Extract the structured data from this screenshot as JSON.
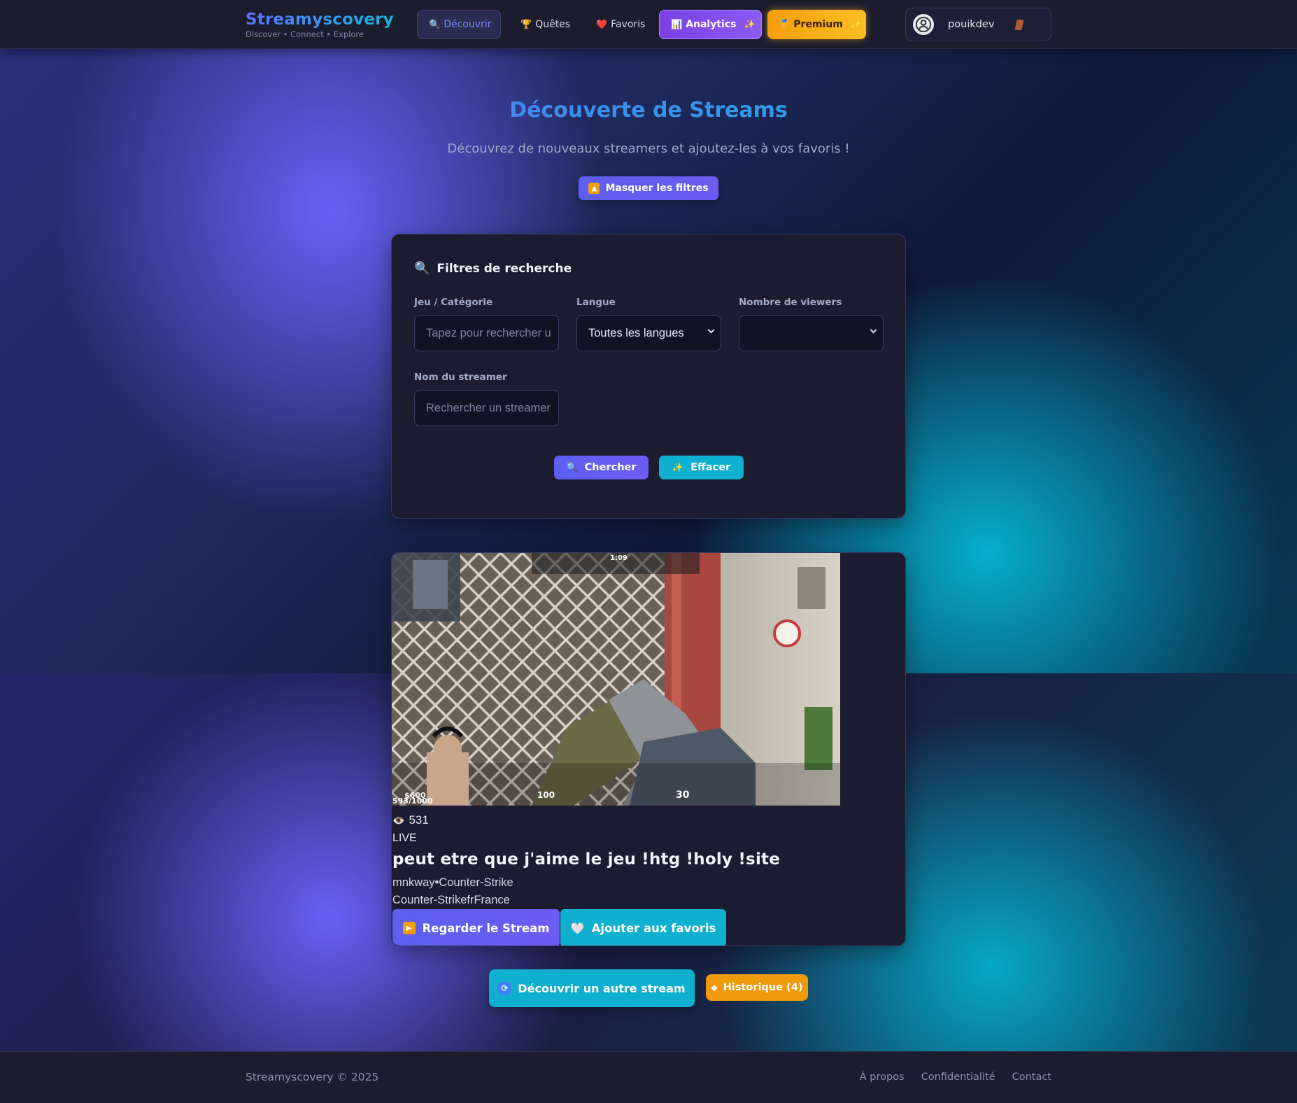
{
  "header": {
    "brand_name": "Streamyscovery",
    "brand_tagline": "Discover • Connect • Explore",
    "nav": {
      "decouvrir": "Découvrir",
      "quetes": "Quêtes",
      "favoris": "Favoris",
      "analytics": "Analytics",
      "premium": "Premium"
    },
    "user": {
      "name": "pouikdev"
    }
  },
  "hero": {
    "title": "Découverte de Streams",
    "subtitle": "Découvrez de nouveaux streamers et ajoutez-les à vos favoris !",
    "toggle_filters": "Masquer les filtres"
  },
  "filters": {
    "title": "Filtres de recherche",
    "game_label": "Jeu / Catégorie",
    "game_placeholder": "Tapez pour rechercher u",
    "language_label": "Langue",
    "language_value": "Toutes les langues",
    "viewers_label": "Nombre de viewers",
    "viewers_value": "",
    "streamer_label": "Nom du streamer",
    "streamer_placeholder": "Rechercher un streamer",
    "search_button": "Chercher",
    "clear_button": "Effacer"
  },
  "stream": {
    "viewers": "531",
    "status": "LIVE",
    "title": "peut etre que j'aime le jeu !htg !holy !site",
    "streamer": "mnkway",
    "separator": "•",
    "game": "Counter-Strike",
    "tags": "Counter-StrikefrFrance",
    "thumbnail_overlay": {
      "money": "$600",
      "health": "100",
      "ammo": "30",
      "goal": "593/1000",
      "timer": "1:09"
    },
    "watch_button": "Regarder le Stream",
    "fav_button": "Ajouter aux favoris"
  },
  "actions": {
    "discover_another": "Découvrir un autre stream",
    "history": "Historique (4)"
  },
  "footer": {
    "copyright": "Streamyscovery © 2025",
    "links": [
      "À propos",
      "Confidentialité",
      "Contact"
    ]
  },
  "colors": {
    "primary": "#6366f1",
    "accent_cyan": "#06b6d4",
    "premium": "#fbbf24",
    "analytics": "#8b5cf6",
    "history": "#f59e0b",
    "panel_bg": "#1b1c30"
  },
  "icons": {
    "decouvrir": "search-icon",
    "quetes": "trophy-icon",
    "favoris": "heart-icon",
    "analytics": "bar-chart-icon",
    "premium": "medal-icon",
    "sparkle": "sparkle-icon",
    "toggle": "up-arrow-icon",
    "watch": "play-icon",
    "fav": "white-heart-icon",
    "refresh": "refresh-icon",
    "viewers": "eye-icon"
  }
}
